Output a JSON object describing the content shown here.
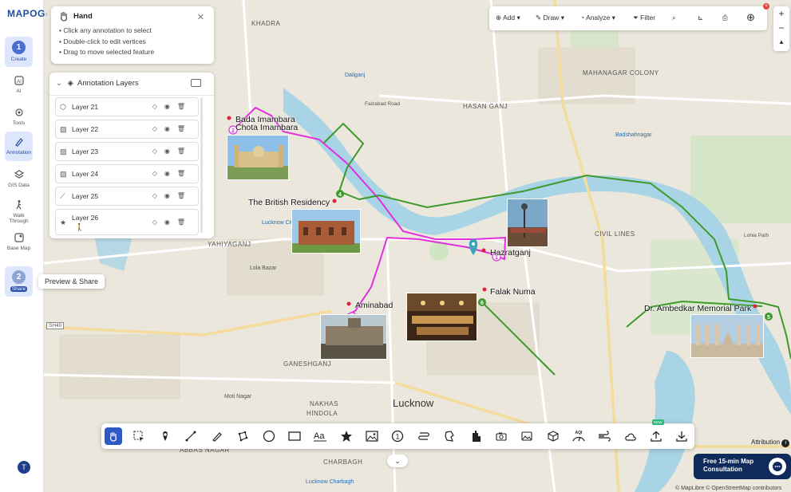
{
  "app": {
    "logo_text": "MAPOG"
  },
  "sidebar": {
    "items": [
      {
        "label": "Create",
        "badge": "1",
        "active": true
      },
      {
        "label": "AI"
      },
      {
        "label": "Tools"
      },
      {
        "label": "Annotation"
      },
      {
        "label": "GIS Data"
      },
      {
        "label": "Walk Through"
      },
      {
        "label": "Base Map"
      },
      {
        "label": "Share",
        "badge": "2"
      }
    ],
    "avatar": "T",
    "tooltip": "Preview & Share"
  },
  "hand_panel": {
    "title": "Hand",
    "tips": [
      "• Click any annotation to select",
      "• Double-click to edit vertices",
      "• Drag to move selected feature"
    ]
  },
  "layers_panel": {
    "title": "Annotation Layers",
    "layers": [
      {
        "name": "Layer 21",
        "icon": "polygon-icon"
      },
      {
        "name": "Layer 22",
        "icon": "image-icon"
      },
      {
        "name": "Layer 23",
        "icon": "image-icon"
      },
      {
        "name": "Layer 24",
        "icon": "image-icon"
      },
      {
        "name": "Layer 25",
        "icon": "line-icon"
      },
      {
        "name": "Layer 26",
        "icon": "star-icon"
      }
    ]
  },
  "top_toolbar": {
    "add": "Add",
    "draw": "Draw",
    "analyze": "Analyze",
    "filter": "Filter"
  },
  "zoom": {
    "in": "+",
    "out": "−",
    "reset": "▲"
  },
  "map": {
    "area_labels": [
      "KHADRA",
      "HASAN GANJ",
      "MAHANAGAR COLONY",
      "CIVIL LINES",
      "YAHIYAGANJ",
      "GANESHGANJ",
      "NAKHAS",
      "HINDOLA",
      "CHARBAGH",
      "ABBAS NAGAR",
      "Lucknow"
    ],
    "poi_labels": [
      "Daliganj",
      "Badshahnagar",
      "Lucknow City",
      "Lucknow Charbagh",
      "Lohia Path",
      "Moti Nagar",
      "Lola Bazar",
      "Faizabad Road",
      "SH40"
    ],
    "places": [
      {
        "name": "Bada Imambara\nChota Imambara",
        "number": "2"
      },
      {
        "name": "The British Residency"
      },
      {
        "name": "Hazratganj"
      },
      {
        "name": "Falak Numa"
      },
      {
        "name": "Aminabad",
        "number": "3"
      },
      {
        "name": "Dr. Ambedkar Memorial Park"
      }
    ],
    "route_numbers": [
      "4",
      "5",
      "6"
    ],
    "route_colors": {
      "walk": "#e02fe0",
      "drive": "#3e9a2a",
      "river": "#3aa0d0"
    }
  },
  "bottom_toolbar": {
    "tools": [
      "hand-icon",
      "select-icon",
      "marker-icon",
      "line-icon",
      "freehand-icon",
      "polygon-icon",
      "circle-icon",
      "rectangle-icon",
      "text-icon",
      "star-icon",
      "image-icon",
      "number-icon",
      "route-icon",
      "area-icon",
      "building-icon",
      "camera-icon",
      "photo-icon",
      "cube-icon",
      "aqi-icon",
      "wind-icon",
      "weather-icon",
      "upload-icon",
      "download-icon"
    ],
    "new_badge": "NEW",
    "aqi_label": "AQI"
  },
  "attribution": "Attribution",
  "consult": {
    "line1": "Free 15-min Map",
    "line2": "Consultation"
  },
  "credits": "© MapLibre © OpenStreetMap contributors"
}
